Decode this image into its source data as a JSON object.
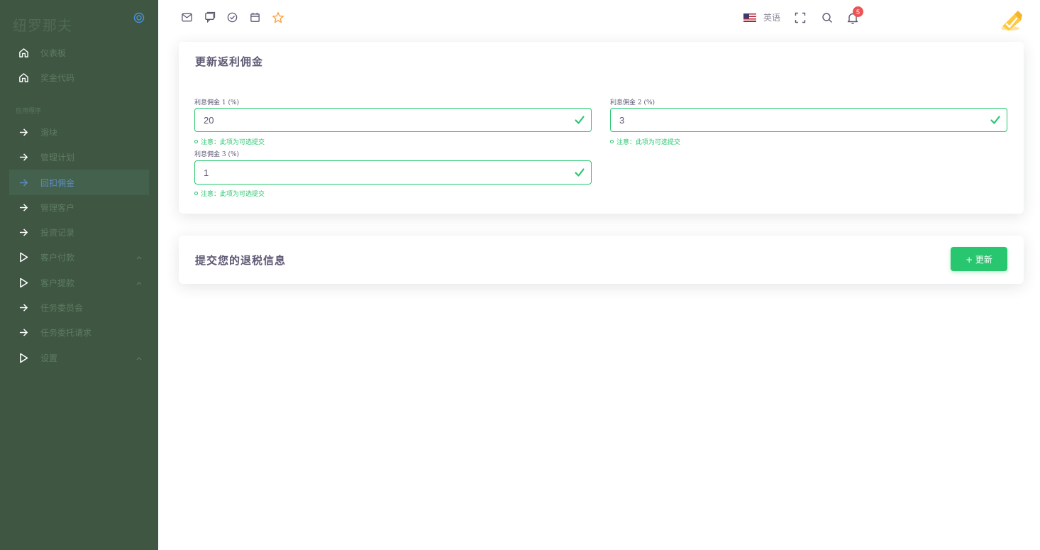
{
  "brand": {
    "name": "纽罗那夫"
  },
  "sidebar": {
    "items": [
      {
        "label": "仪表板",
        "icon": "home-icon"
      },
      {
        "label": "奖金代码",
        "icon": "home-icon"
      }
    ],
    "section_label": "应用程序",
    "app_items": [
      {
        "label": "滑块",
        "icon": "arrow-right-icon",
        "active": false
      },
      {
        "label": "管理计划",
        "icon": "arrow-right-icon",
        "active": false
      },
      {
        "label": "回扣佣金",
        "icon": "arrow-right-icon",
        "active": true
      },
      {
        "label": "管理客户",
        "icon": "arrow-right-icon",
        "active": false
      },
      {
        "label": "投资记录",
        "icon": "arrow-right-icon",
        "active": false
      },
      {
        "label": "客户付款",
        "icon": "play-icon",
        "expandable": true
      },
      {
        "label": "客户提款",
        "icon": "play-icon",
        "expandable": true
      },
      {
        "label": "任务委员会",
        "icon": "arrow-right-icon",
        "active": false
      },
      {
        "label": "任务委托请求",
        "icon": "arrow-right-icon",
        "active": false
      },
      {
        "label": "设置",
        "icon": "play-icon",
        "expandable": true
      }
    ]
  },
  "topbar": {
    "language": "英语",
    "notification_count": "5"
  },
  "rebate_card": {
    "title": "更新返利佣金",
    "fields": [
      {
        "label": "利息佣金 1 (%)",
        "value": "20",
        "note": "注意：此项为可选提交"
      },
      {
        "label": "利息佣金 2 (%)",
        "value": "3",
        "note": "注意：此项为可选提交"
      },
      {
        "label": "利息佣金 3 (%)",
        "value": "1",
        "note": "注意：此项为可选提交"
      }
    ]
  },
  "tax_card": {
    "title": "提交您的退税信息",
    "button_label": "+ 更新"
  },
  "colors": {
    "sidebar_bg": "#3e5642",
    "success": "#28c76f",
    "active_link": "#5d8cc0",
    "badge": "#ea5455",
    "star": "#ff9f43"
  }
}
